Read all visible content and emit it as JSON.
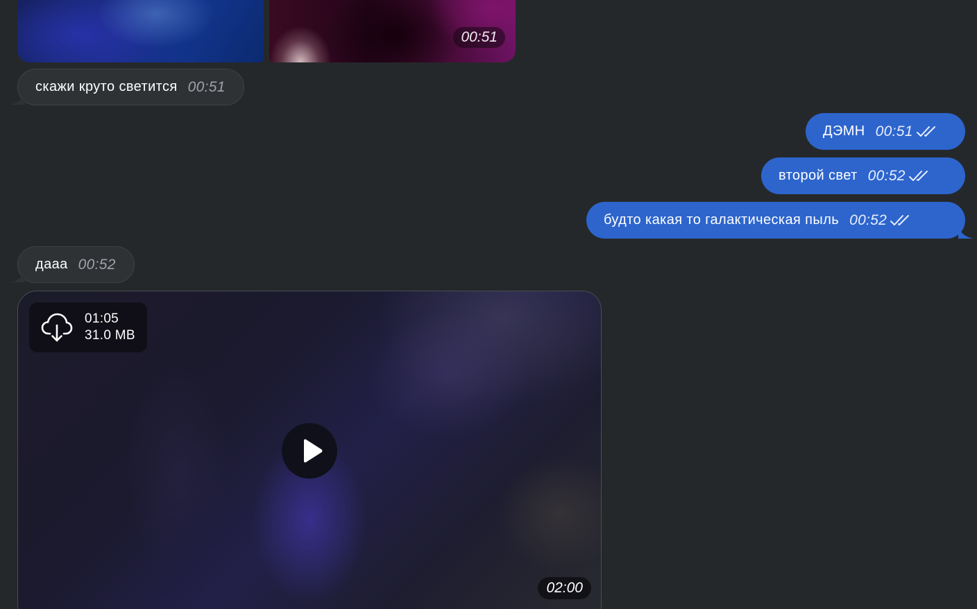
{
  "photos": {
    "album_time": "00:51"
  },
  "messages": [
    {
      "text": "скажи круто светится",
      "time": "00:51",
      "direction": "incoming"
    },
    {
      "text": "ДЭМН",
      "time": "00:51",
      "direction": "outgoing",
      "status_icon": "double-check-icon"
    },
    {
      "text": "второй свет",
      "time": "00:52",
      "direction": "outgoing",
      "status_icon": "double-check-icon"
    },
    {
      "text": "будто какая то галактическая пыль",
      "time": "00:52",
      "direction": "outgoing",
      "status_icon": "double-check-icon"
    },
    {
      "text": "дааа",
      "time": "00:52",
      "direction": "incoming"
    }
  ],
  "video": {
    "duration": "01:05",
    "size": "31.0 MB",
    "time": "02:00",
    "download_icon": "cloud-download-icon",
    "play_icon": "play-icon"
  },
  "colors": {
    "background": "#25282b",
    "incoming_bubble": "#2f3235",
    "outgoing_bubble": "#2d65cd"
  }
}
